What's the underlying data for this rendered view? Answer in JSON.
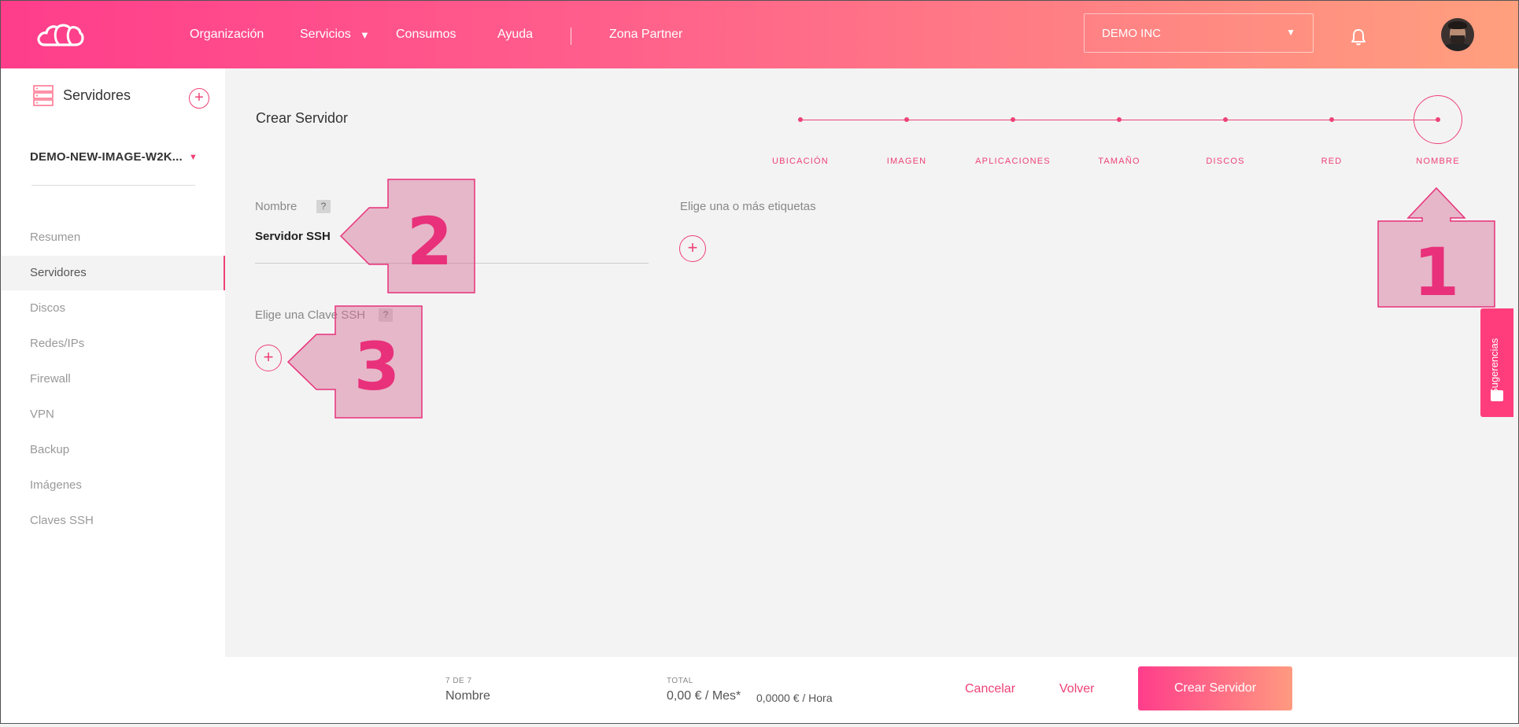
{
  "header": {
    "nav": {
      "organizacion": "Organización",
      "servicios": "Servicios",
      "consumos": "Consumos",
      "ayuda": "Ayuda",
      "zona_partner": "Zona Partner"
    },
    "org_select": {
      "value": "DEMO INC",
      "caret": "▼"
    }
  },
  "sidebar": {
    "title": "Servidores",
    "add_label": "+",
    "selector": {
      "value": "DEMO-NEW-IMAGE-W2K...",
      "caret": "▼"
    },
    "items": [
      {
        "label": "Resumen",
        "active": false
      },
      {
        "label": "Servidores",
        "active": true
      },
      {
        "label": "Discos",
        "active": false
      },
      {
        "label": "Redes/IPs",
        "active": false
      },
      {
        "label": "Firewall",
        "active": false
      },
      {
        "label": "VPN",
        "active": false
      },
      {
        "label": "Backup",
        "active": false
      },
      {
        "label": "Imágenes",
        "active": false
      },
      {
        "label": "Claves SSH",
        "active": false
      }
    ]
  },
  "main": {
    "title": "Crear Servidor",
    "steps": [
      "UBICACIÓN",
      "IMAGEN",
      "APLICACIONES",
      "TAMAÑO",
      "DISCOS",
      "RED",
      "NOMBRE"
    ],
    "current_step": 7,
    "name_label": "Nombre",
    "name_help": "?",
    "name_value": "Servidor SSH",
    "tags_label": "Elige una o más etiquetas",
    "tags_add": "+",
    "ssh_label": "Elige una Clave SSH",
    "ssh_help": "?",
    "ssh_add": "+"
  },
  "annotations": {
    "one": "1",
    "two": "2",
    "three": "3"
  },
  "feedback": {
    "label": "Sugerencias"
  },
  "footer": {
    "step_count": "7 DE 7",
    "step_name": "Nombre",
    "total_label": "TOTAL",
    "monthly": "0,00 € / Mes*",
    "hourly": "0,0000 € / Hora",
    "cancel": "Cancelar",
    "back": "Volver",
    "create": "Crear Servidor"
  },
  "colors": {
    "accent": "#ee4277",
    "gradient_start": "#ff3d8b",
    "gradient_end": "#ffa07e"
  }
}
